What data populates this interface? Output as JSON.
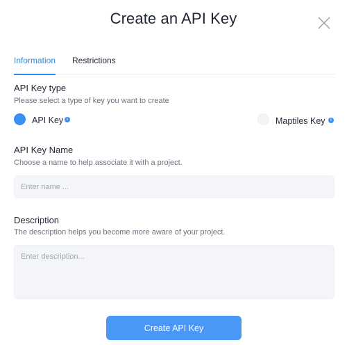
{
  "modal": {
    "title": "Create an API Key"
  },
  "tabs": [
    {
      "label": "Information"
    },
    {
      "label": "Restrictions"
    }
  ],
  "key_type": {
    "title": "API Key type",
    "description": "Please select a type of key you want to create",
    "options": [
      {
        "label": "API Key",
        "selected": true,
        "info_icon": "info-icon"
      },
      {
        "label": "Maptiles Key",
        "selected": false,
        "info_icon": "info-icon"
      }
    ]
  },
  "name": {
    "title": "API Key Name",
    "description": "Choose a name to help associate it with a project.",
    "placeholder": "Enter name ...",
    "value": ""
  },
  "description": {
    "title": "Description",
    "description": "The description helps you become more aware of your project.",
    "placeholder": "Enter description...",
    "value": ""
  },
  "submit": {
    "label": "Create API Key"
  },
  "colors": {
    "accent": "#2b8ce8",
    "button": "#4a97f5",
    "field_bg": "#f4f5f8"
  }
}
